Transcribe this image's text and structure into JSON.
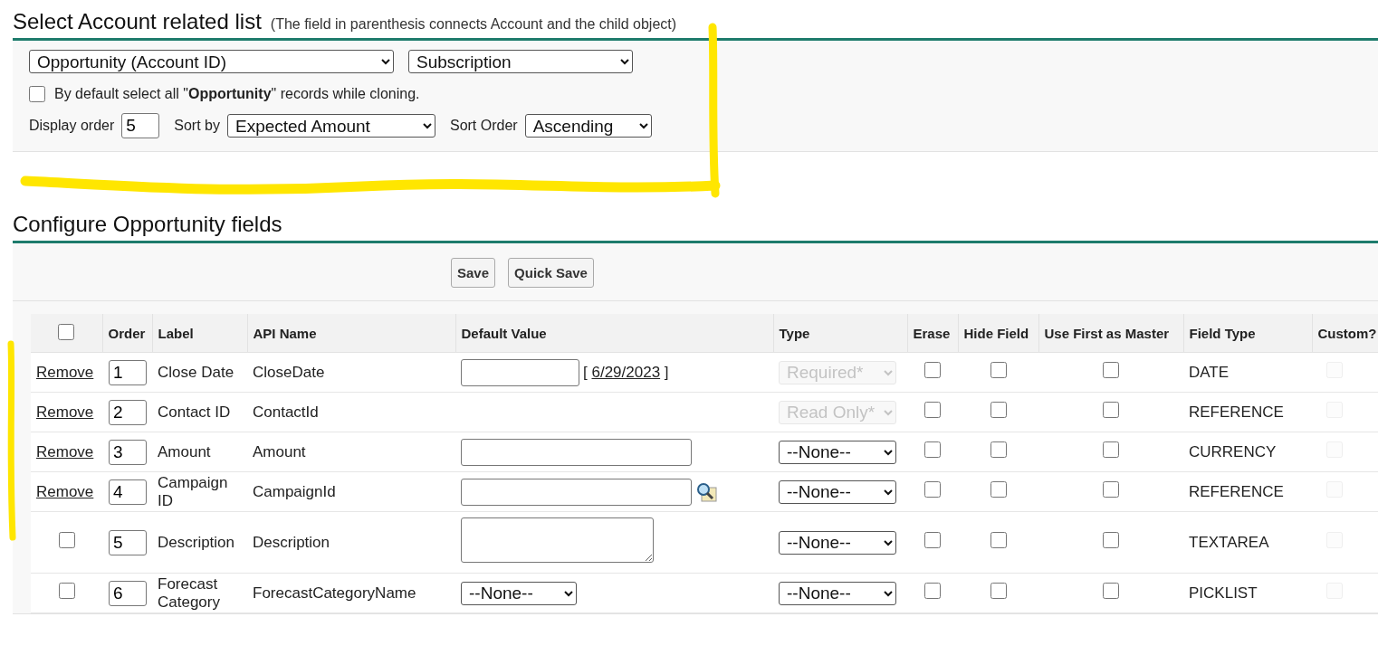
{
  "section1": {
    "title": "Select Account related list",
    "note": "(The field in parenthesis connects Account and the child object)",
    "related_list": "Opportunity (Account ID)",
    "record_type": "Subscription",
    "default_select": {
      "text": "By default select all \"**Opportunity**\" records while cloning.",
      "checked": false
    },
    "display_order_label": "Display order",
    "display_order": "5",
    "sort_by_label": "Sort by",
    "sort_by": "Expected Amount",
    "sort_order_label": "Sort Order",
    "sort_order": "Ascending"
  },
  "section2": {
    "title": "Configure Opportunity fields",
    "buttons": [
      "Save",
      "Quick Save"
    ],
    "table": {
      "select_all_checked": false,
      "columns": [
        "Order",
        "Label",
        "API Name",
        "Default Value",
        "Type",
        "Erase",
        "Hide Field",
        "Use First as Master",
        "Field Type",
        "Custom?"
      ],
      "rows": [
        {
          "lead": {
            "kind": "remove",
            "text": "Remove"
          },
          "order": "1",
          "label": "Close Date",
          "api_name": "CloseDate",
          "default": {
            "kind": "date",
            "before": "[",
            "link": "6/29/2023",
            "after": "]"
          },
          "type": {
            "value": "Required*",
            "disabled": true
          },
          "erase": false,
          "hide": false,
          "master": false,
          "field_type": "DATE",
          "custom": false
        },
        {
          "lead": {
            "kind": "remove",
            "text": "Remove"
          },
          "order": "2",
          "label": "Contact ID",
          "api_name": "ContactId",
          "default": {
            "kind": "none"
          },
          "type": {
            "value": "Read Only*",
            "disabled": true
          },
          "erase": false,
          "hide": false,
          "master": false,
          "field_type": "REFERENCE",
          "custom": false
        },
        {
          "lead": {
            "kind": "remove",
            "text": "Remove"
          },
          "order": "3",
          "label": "Amount",
          "api_name": "Amount",
          "default": {
            "kind": "text"
          },
          "type": {
            "value": "--None--",
            "disabled": false
          },
          "erase": false,
          "hide": false,
          "master": false,
          "field_type": "CURRENCY",
          "custom": false
        },
        {
          "lead": {
            "kind": "remove",
            "text": "Remove"
          },
          "order": "4",
          "label": "Campaign ID",
          "api_name": "CampaignId",
          "default": {
            "kind": "lookup"
          },
          "type": {
            "value": "--None--",
            "disabled": false
          },
          "erase": false,
          "hide": false,
          "master": false,
          "field_type": "REFERENCE",
          "custom": false
        },
        {
          "lead": {
            "kind": "checkbox",
            "checked": false
          },
          "order": "5",
          "label": "Description",
          "api_name": "Description",
          "default": {
            "kind": "textarea"
          },
          "type": {
            "value": "--None--",
            "disabled": false
          },
          "erase": false,
          "hide": false,
          "master": false,
          "field_type": "TEXTAREA",
          "custom": false
        },
        {
          "lead": {
            "kind": "checkbox",
            "checked": false
          },
          "order": "6",
          "label": "Forecast Category",
          "api_name": "ForecastCategoryName",
          "default": {
            "kind": "select",
            "value": "--None--"
          },
          "type": {
            "value": "--None--",
            "disabled": false
          },
          "erase": false,
          "hide": false,
          "master": false,
          "field_type": "PICKLIST",
          "custom": false
        }
      ]
    }
  }
}
